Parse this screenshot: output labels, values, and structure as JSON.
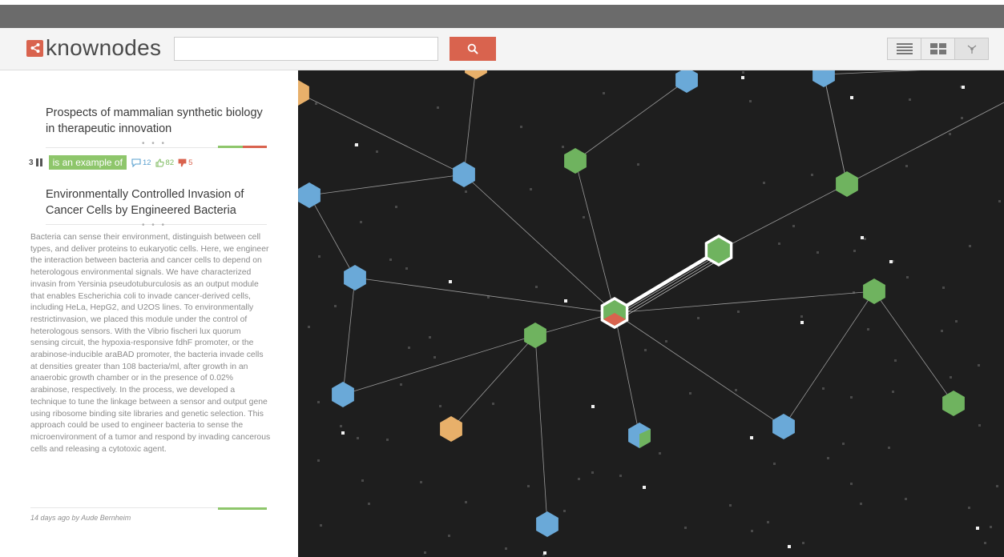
{
  "app": {
    "name": "knownodes",
    "brand_color": "#d9634e"
  },
  "header": {
    "search": {
      "value": "",
      "placeholder": "",
      "button_icon": "search-icon"
    },
    "view_modes": [
      {
        "icon": "list-view-icon",
        "active": false
      },
      {
        "icon": "grid-view-icon",
        "active": false
      },
      {
        "icon": "graph-view-icon",
        "active": true
      }
    ]
  },
  "sidebar": {
    "source_title": "Prospects of mammalian synthetic biology in therapeutic innovation",
    "connection": {
      "count": "3",
      "label": "is an example of",
      "comments": "12",
      "likes": "82",
      "dislikes": "5"
    },
    "target_title": "Environmentally Controlled Invasion of Cancer Cells by Engineered Bacteria",
    "abstract": "Bacteria can sense their environment, distinguish between cell types, and deliver proteins to eukaryotic cells. Here, we engineer the interaction between bacteria and cancer cells to depend on heterologous environmental signals. We have characterized invasin from Yersinia pseudotuburculosis as an output module that enables Escherichia coli to invade cancer-derived cells, including HeLa, HepG2, and U2OS lines. To environmentally restrictinvasion, we placed this module under the control of heterologous sensors. With the Vibrio fischeri lux quorum sensing circuit, the hypoxia-responsive fdhF promoter, or the arabinose-inducible araBAD promoter, the bacteria invade cells at densities greater than 108 bacteria/ml, after growth in an anaerobic growth chamber or in the presence of 0.02% arabinose, respectively. In the process, we developed a technique to tune the linkage between a sensor and output gene using ribosome binding site libraries and genetic selection. This approach could be used to engineer bacteria to sense the microenvironment of a tumor and respond by invading cancerous cells and releasing a cytotoxic agent.",
    "meta": "14 days ago by Aude Bernheim"
  },
  "graph": {
    "colors": {
      "background": "#1e1e1e",
      "blue": "#6aa9d8",
      "green": "#6fb35f",
      "orange": "#e8b06a",
      "red": "#d9634e"
    }
  }
}
